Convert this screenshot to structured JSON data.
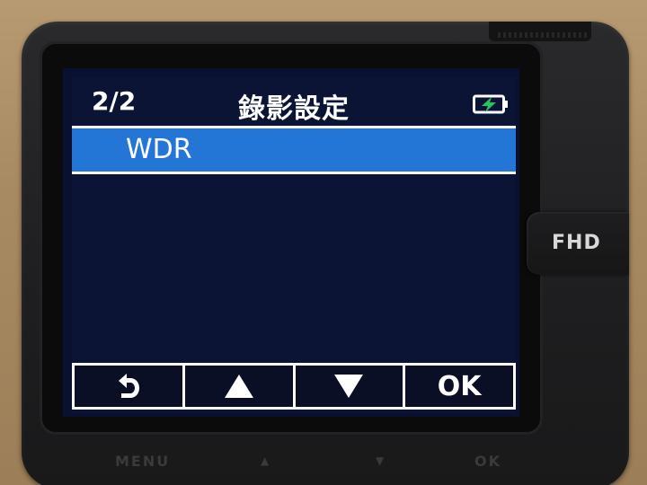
{
  "header": {
    "page_indicator": "2/2",
    "title": "錄影設定",
    "battery_icon": "battery-charging-icon"
  },
  "menu": {
    "items": [
      {
        "label": "WDR",
        "selected": true
      }
    ]
  },
  "softkeys": [
    {
      "icon": "back-icon"
    },
    {
      "icon": "up-triangle-icon"
    },
    {
      "icon": "down-triangle-icon"
    },
    {
      "label": "OK"
    }
  ],
  "device": {
    "mode_button": "FHD",
    "hardware_labels": {
      "menu": "MENU",
      "up": "▲",
      "down": "▼",
      "ok": "OK"
    }
  },
  "colors": {
    "screen_bg": "#0c1436",
    "highlight": "#2476d6",
    "battery_bolt": "#27c35f"
  }
}
